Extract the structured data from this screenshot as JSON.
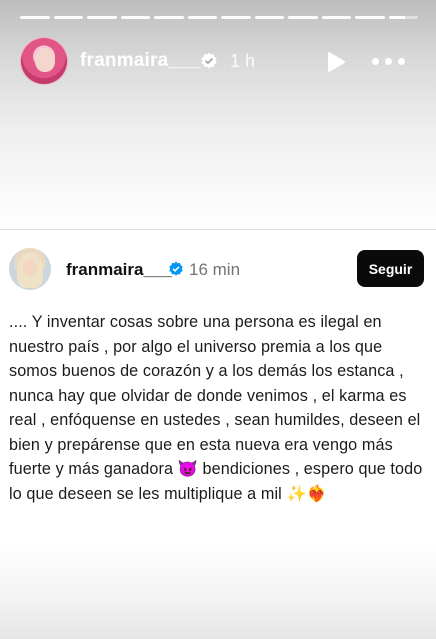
{
  "story_header": {
    "progress_segments": 12,
    "current_segment": 12,
    "username": "franmaira___",
    "time": "1 h",
    "icons": {
      "verified": "verified-badge-icon",
      "play": "play-icon",
      "more": "more-options-icon"
    }
  },
  "post": {
    "username": "franmaira___",
    "time": "16 min",
    "follow_label": "Seguir",
    "body_text": ".... Y inventar cosas sobre una persona es ilegal en nuestro país , por algo el universo premia a los que somos buenos de corazón y a los demás los estanca , nunca hay que olvidar de donde venimos , el karma es real , enfóquense en ustedes , sean humildes, deseen el bien  y prepárense que en esta nueva era vengo más fuerte y más ganadora 😈 bendiciones , espero que todo lo que deseen se les multiplique a mil ✨❤️‍🔥"
  },
  "colors": {
    "verified_blue": "#0095f6",
    "follow_bg": "#0a0a0a",
    "text_dark": "#1b1b1b",
    "meta_gray": "#737373"
  }
}
